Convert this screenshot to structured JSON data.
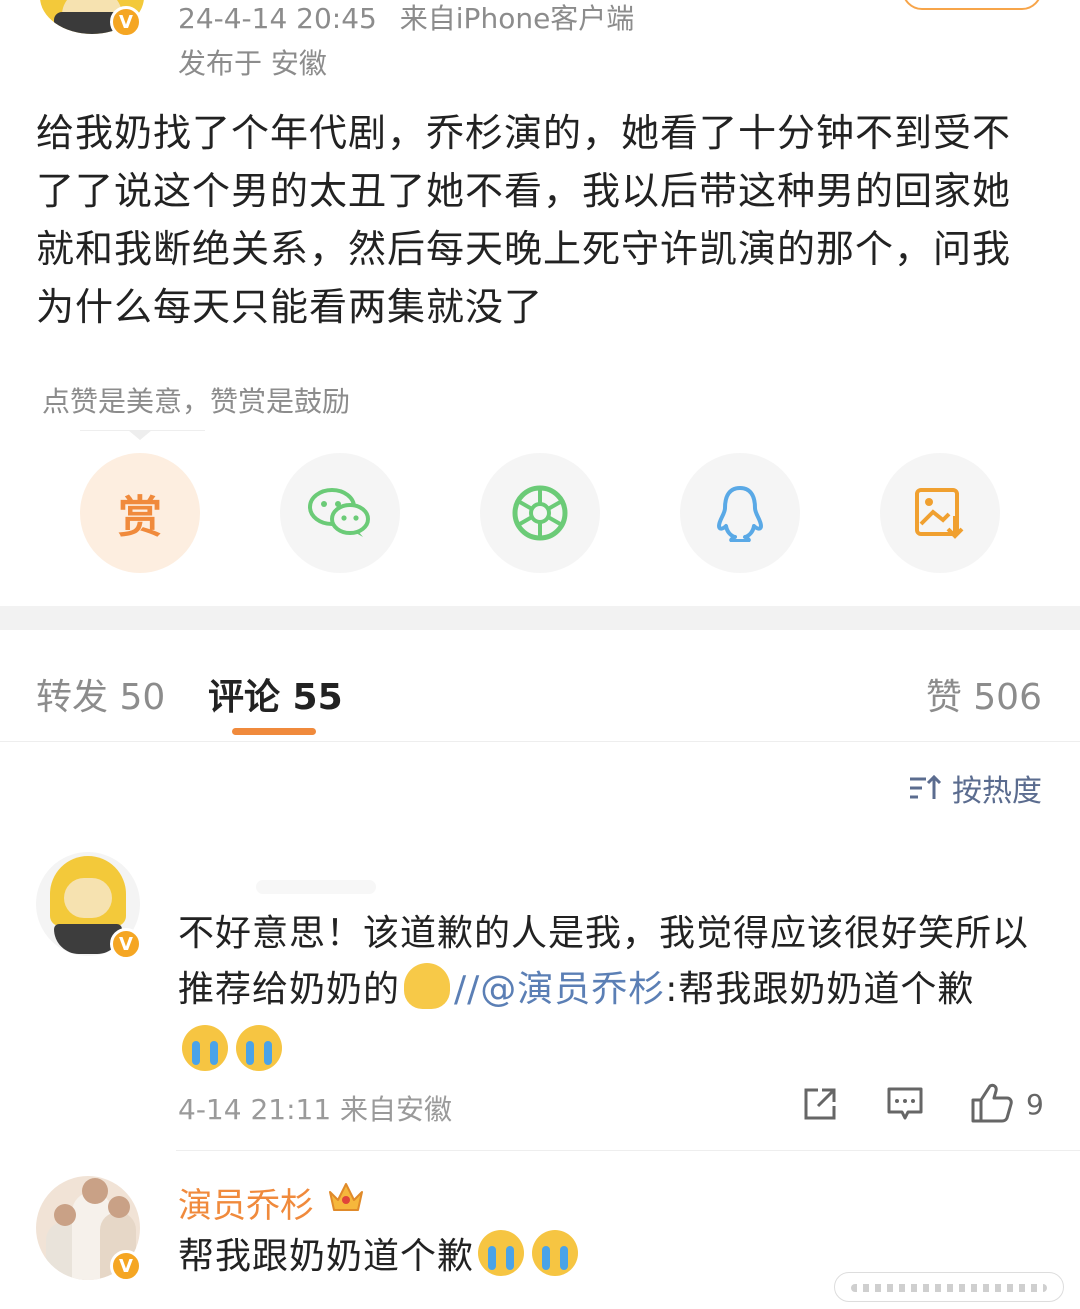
{
  "post": {
    "datetime": "24-4-14 20:45",
    "source": "来自iPhone客户端",
    "location": "发布于 安徽",
    "text": "给我奶找了个年代剧，乔杉演的，她看了十分钟不到受不了了说这个男的太丑了她不看，我以后带这种男的回家她就和我断绝关系，然后每天晚上死守许凯演的那个，问我为什么每天只能看两集就没了"
  },
  "reward_tip": "点赞是美意，赞赏是鼓励",
  "share": {
    "reward_label": "赏",
    "items": [
      "reward",
      "wechat",
      "moments",
      "qq",
      "save-image"
    ]
  },
  "tabs": {
    "repost": "转发 50",
    "comment": "评论 55",
    "like": "赞 506"
  },
  "sort_label": "按热度",
  "comment": {
    "text_part1": "不好意思！该道歉的人是我，我觉得应该很好笑所以推荐给奶奶的",
    "separator": "//",
    "mention": "@演员乔杉",
    "text_part2": ":帮我跟奶奶道个歉",
    "meta": "4-14 21:11 来自安徽",
    "like_count": "9"
  },
  "reply": {
    "name": "演员乔杉",
    "text": "帮我跟奶奶道个歉"
  },
  "colors": {
    "accent": "#f08a3c",
    "link": "#5b7fb5",
    "muted": "#8c8c8c",
    "wechat": "#6bcb77",
    "qq": "#5aa9e6",
    "reward_bg": "#fdeee0"
  }
}
